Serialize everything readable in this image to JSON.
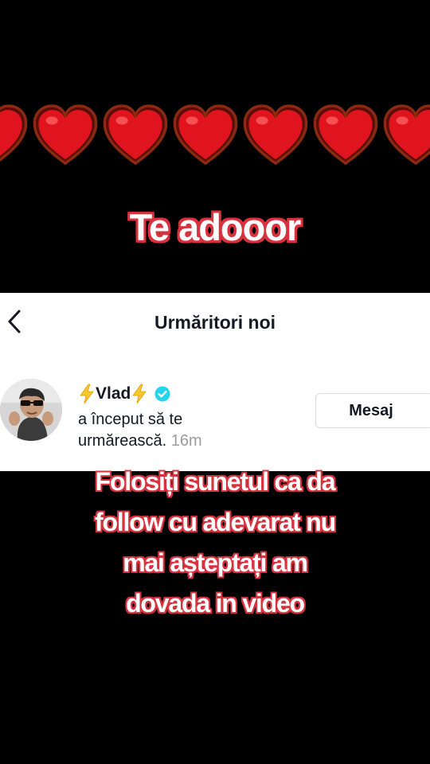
{
  "overlay": {
    "title": "Te adooor",
    "caption_lines": [
      "Folosiți sunetul ca da",
      "follow cu adevarat nu",
      "mai așteptați am",
      "dovada in video"
    ]
  },
  "hearts": {
    "icon": "red-heart-emoji",
    "color": "#e0141e"
  },
  "notification_panel": {
    "back_icon": "chevron-left-icon",
    "title": "Urmăritori noi",
    "user": {
      "prefix_emoji": "⚡",
      "name": "Vlad",
      "suffix_emoji": "⚡",
      "verified_icon": "verified-badge-icon",
      "activity_text_line1": "a început să te",
      "activity_text_line2": "urmărească.",
      "time_ago": "16m"
    },
    "message_button_label": "Mesaj"
  },
  "colors": {
    "text_outline": "#d8323f",
    "verified": "#20d5ec",
    "panel_bg": "#ffffff",
    "background": "#000000"
  }
}
